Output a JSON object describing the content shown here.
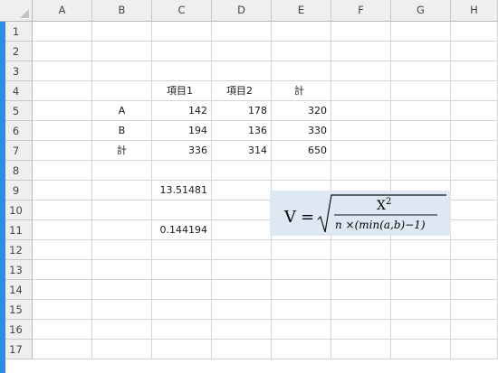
{
  "columns": [
    "A",
    "B",
    "C",
    "D",
    "E",
    "F",
    "G",
    "H"
  ],
  "rows": [
    "1",
    "2",
    "3",
    "4",
    "5",
    "6",
    "7",
    "8",
    "9",
    "10",
    "11",
    "12",
    "13",
    "14",
    "15",
    "16",
    "17"
  ],
  "table": {
    "header": {
      "c": "項目1",
      "d": "項目2",
      "e": "計"
    },
    "rows": [
      {
        "label": "A",
        "c": "142",
        "d": "178",
        "e": "320"
      },
      {
        "label": "B",
        "c": "194",
        "d": "136",
        "e": "330"
      },
      {
        "label": "計",
        "c": "336",
        "d": "314",
        "e": "650"
      }
    ]
  },
  "results": {
    "c9": "13.51481",
    "c11": "0.144194"
  },
  "formula": {
    "lhs": "V",
    "equals": "=",
    "numerator_base": "X",
    "numerator_exp": "2",
    "denominator": "n ×(min(a,b)−1)"
  },
  "colors": {
    "header_bg": "#efefef",
    "gridline": "#d6d6d6",
    "formula_bg": "#dde8f3",
    "left_accent": "#2b8de3"
  }
}
